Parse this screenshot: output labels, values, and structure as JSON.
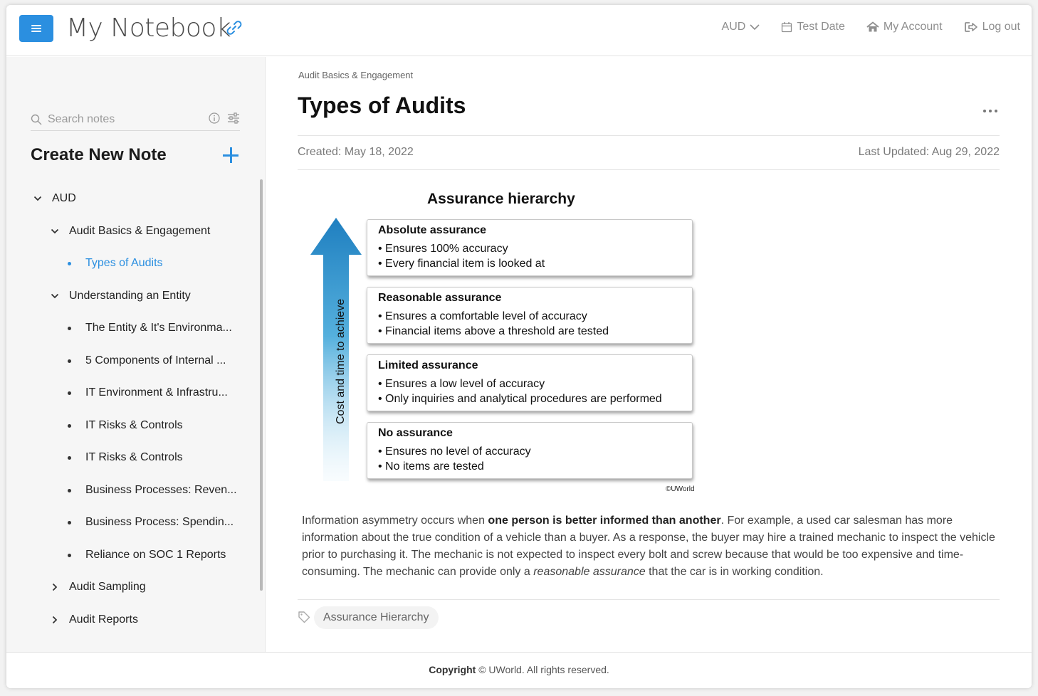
{
  "header": {
    "title": "My Notebook",
    "nav": {
      "section": "AUD",
      "test_date": "Test Date",
      "account": "My Account",
      "logout": "Log out"
    }
  },
  "sidebar": {
    "search_placeholder": "Search notes",
    "create_label": "Create New Note",
    "tree": [
      {
        "label": "AUD",
        "level": 0,
        "type": "expanded"
      },
      {
        "label": "Audit Basics & Engagement",
        "level": 1,
        "type": "expanded"
      },
      {
        "label": "Types of Audits",
        "level": 2,
        "type": "leaf",
        "active": true
      },
      {
        "label": "Understanding an Entity",
        "level": 1,
        "type": "expanded"
      },
      {
        "label": "The Entity & It's Environma...",
        "level": 2,
        "type": "leaf"
      },
      {
        "label": "5 Components of Internal ...",
        "level": 2,
        "type": "leaf"
      },
      {
        "label": "IT Environment & Infrastru...",
        "level": 2,
        "type": "leaf"
      },
      {
        "label": "IT Risks & Controls",
        "level": 2,
        "type": "leaf"
      },
      {
        "label": "IT Risks & Controls",
        "level": 2,
        "type": "leaf"
      },
      {
        "label": "Business Processes: Reven...",
        "level": 2,
        "type": "leaf"
      },
      {
        "label": "Business Process: Spendin...",
        "level": 2,
        "type": "leaf"
      },
      {
        "label": "Reliance on SOC 1 Reports",
        "level": 2,
        "type": "leaf"
      },
      {
        "label": "Audit Sampling",
        "level": 1,
        "type": "collapsed"
      },
      {
        "label": "Audit Reports",
        "level": 1,
        "type": "collapsed"
      }
    ]
  },
  "note": {
    "breadcrumb": "Audit Basics & Engagement",
    "title": "Types of Audits",
    "created": "Created: May 18, 2022",
    "updated": "Last Updated: Aug 29, 2022",
    "diagram": {
      "title": "Assurance hierarchy",
      "arrow_label": "Cost and time to achieve",
      "copyright": "©UWorld",
      "boxes": [
        {
          "title": "Absolute assurance",
          "lines": [
            "• Ensures 100% accuracy",
            "• Every financial item is looked at"
          ]
        },
        {
          "title": "Reasonable assurance",
          "lines": [
            "• Ensures a comfortable level of accuracy",
            "• Financial items above a threshold are tested"
          ]
        },
        {
          "title": "Limited assurance",
          "lines": [
            "• Ensures a low level of accuracy",
            "• Only inquiries and analytical procedures are performed"
          ]
        },
        {
          "title": "No assurance",
          "lines": [
            "• Ensures no level of accuracy",
            "• No items are tested"
          ]
        }
      ]
    },
    "body": {
      "p1": "Information asymmetry occurs when ",
      "p1_bold": "one person is better informed than another",
      "p2": ".  For example, a used car salesman has more information about the true condition of a vehicle than a buyer.  As a response, the buyer may hire a trained mechanic to inspect the vehicle prior to purchasing it.  The mechanic is not expected to inspect every bolt and screw because that would be too expensive and time-consuming.  The mechanic can provide only a ",
      "p2_italic": "reasonable assurance",
      "p3": " that the car is in working condition."
    },
    "tag": "Assurance Hierarchy"
  },
  "footer": {
    "bold": "Copyright",
    "text": " © UWorld. All rights reserved."
  },
  "colors": {
    "accent": "#2b8fe0",
    "arrow_top": "#1f7fc0",
    "arrow_bottom": "#eaf6fc"
  }
}
